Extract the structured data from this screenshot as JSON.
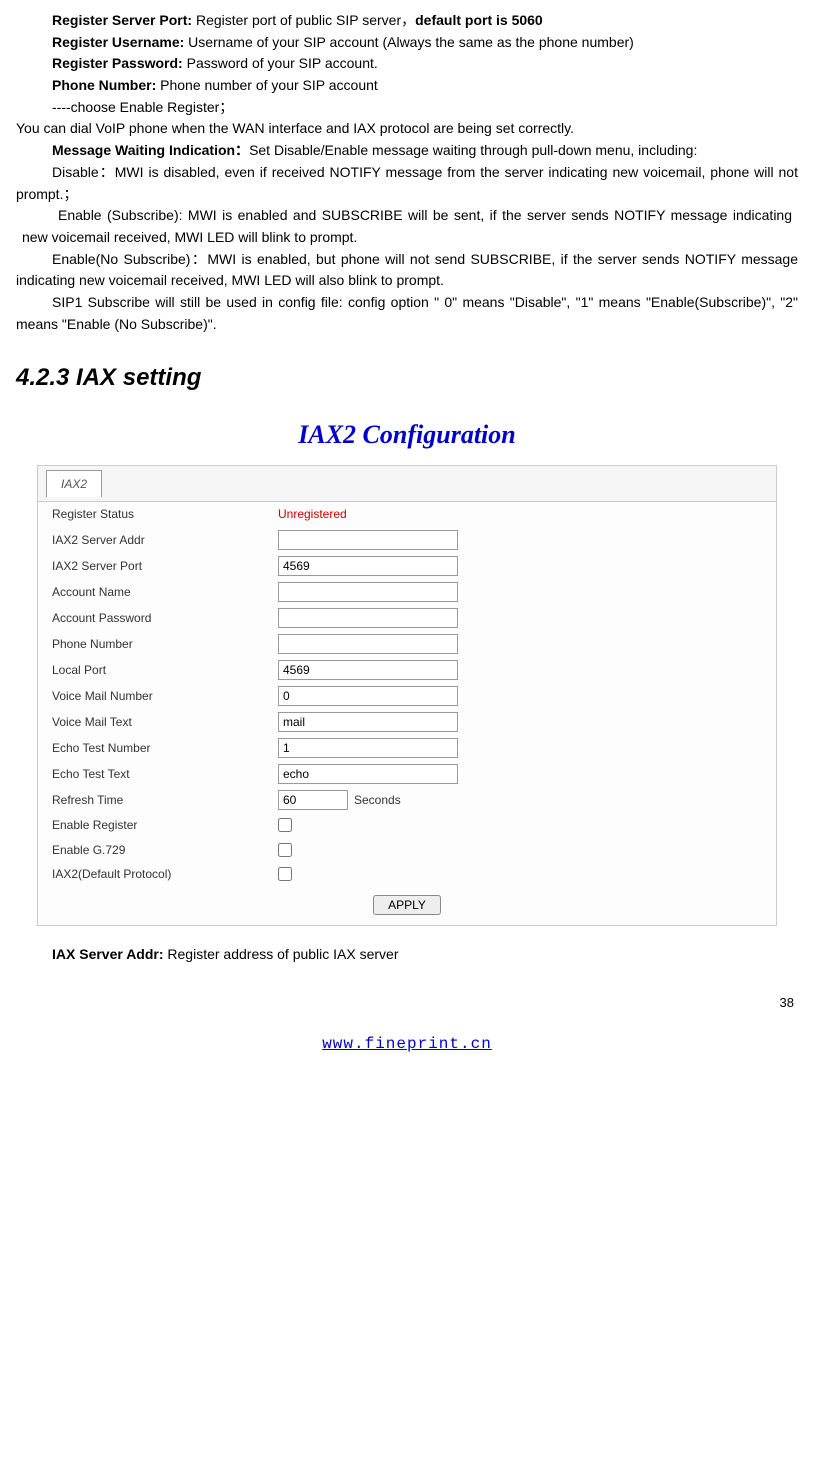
{
  "intro": {
    "register_server_port_label": "Register Server Port:",
    "register_server_port_text": " Register port of public SIP server，",
    "register_server_port_bold_tail": "default port is 5060",
    "register_username_label": "Register Username:",
    "register_username_text": " Username of your SIP account (Always the same as the phone number)",
    "register_password_label": "Register Password:",
    "register_password_text": " Password of your SIP account.",
    "phone_number_label": "Phone Number:",
    "phone_number_text": " Phone number of your SIP account",
    "choose_enable": "----choose Enable Register；",
    "dial_voip": "You can dial VoIP phone when the WAN interface and IAX protocol are being set correctly.",
    "mwi_label": "Message Waiting Indication：",
    "mwi_text": "Set Disable/Enable message waiting through pull-down menu, including:",
    "mwi_disable": "Disable：MWI is disabled, even if received NOTIFY message from the server indicating new voicemail, phone will not prompt.；",
    "mwi_enable_sub": "Enable (Subscribe): MWI is enabled and SUBSCRIBE will be sent, if the server sends NOTIFY message indicating new voicemail received, MWI LED will blink to prompt.",
    "mwi_enable_nosub": "Enable(No Subscribe)：MWI is enabled, but phone will not send SUBSCRIBE, if the server sends NOTIFY message indicating new voicemail received, MWI LED will also blink to prompt.",
    "sip1_subscribe": "SIP1 Subscribe will still be used in config file: config option \" 0\" means \"Disable\", \"1\" means \"Enable(Subscribe)\", \"2\" means \"Enable (No Subscribe)\"."
  },
  "section_title": "4.2.3 IAX setting",
  "config": {
    "title": "IAX2 Configuration",
    "tab": "IAX2",
    "rows": {
      "register_status_label": "Register Status",
      "register_status_value": "Unregistered",
      "server_addr_label": "IAX2 Server Addr",
      "server_addr_value": "",
      "server_port_label": "IAX2 Server Port",
      "server_port_value": "4569",
      "account_name_label": "Account Name",
      "account_name_value": "",
      "account_password_label": "Account Password",
      "account_password_value": "",
      "phone_number_label": "Phone Number",
      "phone_number_value": "",
      "local_port_label": "Local Port",
      "local_port_value": "4569",
      "vm_number_label": "Voice Mail Number",
      "vm_number_value": "0",
      "vm_text_label": "Voice Mail Text",
      "vm_text_value": "mail",
      "echo_num_label": "Echo Test Number",
      "echo_num_value": "1",
      "echo_text_label": "Echo Test Text",
      "echo_text_value": "echo",
      "refresh_label": "Refresh Time",
      "refresh_value": "60",
      "refresh_units": "Seconds",
      "enable_register_label": "Enable Register",
      "enable_g729_label": "Enable G.729",
      "default_protocol_label": "IAX2(Default Protocol)"
    },
    "apply_button": "APPLY"
  },
  "post": {
    "iax_server_addr_label": "IAX Server Addr:",
    "iax_server_addr_text": "   Register address of public IAX server"
  },
  "page_number": "38",
  "footer_link_text": "www.fineprint.cn"
}
